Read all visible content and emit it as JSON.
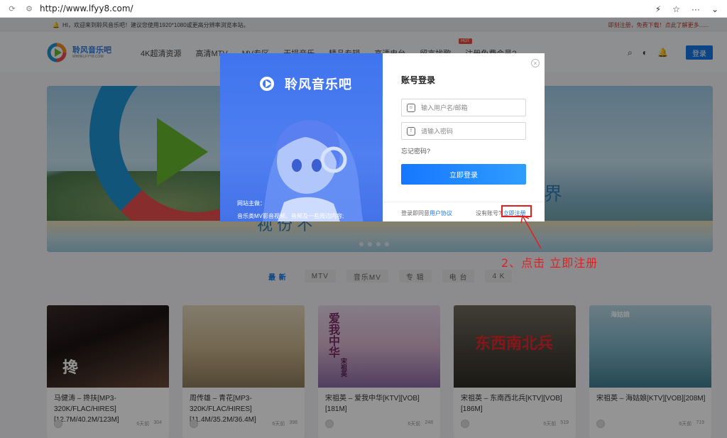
{
  "browser": {
    "url": "http://www.lfyy8.com/"
  },
  "topstrip": {
    "notice": "HI，欢迎来到聆风音乐吧！建议您使用1920*1080或更高分辨率浏览本站。",
    "promo": "即刻注册，免费下载！点此了解更多......"
  },
  "header": {
    "logo_text": "聆风音乐吧",
    "logo_sub": "WWW.LFYY8.COM",
    "nav": [
      "4K超清资源",
      "高清MTV",
      "MV专区",
      "无损音乐",
      "精品专辑",
      "高清电台",
      "留言找歌",
      "注册免费会员?"
    ],
    "hot_badge": "HOT",
    "login": "登录"
  },
  "banner": {
    "slogan": "界",
    "slogan2": "视 份  不"
  },
  "categories": [
    "最 新",
    "MTV",
    "音乐MV",
    "专 辑",
    "电 台",
    "4 K"
  ],
  "cards": [
    {
      "title": "马健涛 – 搀扶[MP3-320K/FLAC/HIRES][12.7M/40.2M/123M]",
      "time": "6天前",
      "views": "304"
    },
    {
      "title": "周传雄 – 青花[MP3-320K/FLAC/HIRES][11.4M/35.2M/36.4M]",
      "time": "6天前",
      "views": "398"
    },
    {
      "title": "宋祖英 – 爱我中华[KTV][VOB][181M]",
      "time": "6天前",
      "views": "248"
    },
    {
      "title": "宋祖英 – 东南西北兵[KTV][VOB][186M]",
      "time": "6天前",
      "views": "519"
    },
    {
      "title": "宋祖英 – 海姑娘[KTV][VOB][208M]",
      "time": "6天前",
      "views": "719"
    }
  ],
  "thumb_texts": {
    "t1": "搀",
    "t3": "爱我中华",
    "t3b": "宋祖英",
    "t4": "东西南北兵",
    "t5": "海姑娘"
  },
  "modal": {
    "brand": "聆风音乐吧",
    "intro1": "网站主做：",
    "intro2": "音乐类MV影音视频、音频及一些周边内容;",
    "title": "账号登录",
    "username_placeholder": "输入用户名/邮箱",
    "password_placeholder": "请输入密码",
    "forgot": "忘记密码?",
    "submit": "立即登录",
    "agree_prefix": "登录即同意",
    "agree_link": "用户协议",
    "no_account": "没有账号?",
    "register": "立即注册",
    "close": "×"
  },
  "annotation": "2、点击 立即注册",
  "colors": {
    "accent": "#1677e5",
    "annotation": "#e02020",
    "modal_left": "#4a7af0"
  }
}
